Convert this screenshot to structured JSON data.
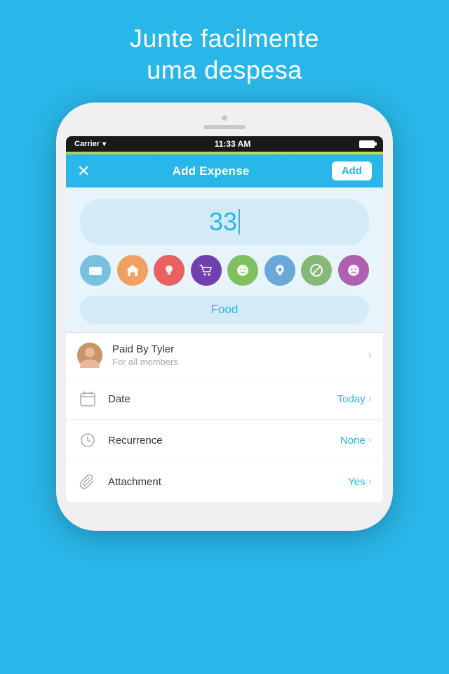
{
  "headline": {
    "line1": "Junte facilmente",
    "line2": "uma despesa"
  },
  "status_bar": {
    "carrier": "Carrier",
    "time": "11:33 AM"
  },
  "nav": {
    "title": "Add Expense",
    "add_label": "Add",
    "close_icon": "✕"
  },
  "amount": {
    "value": "33"
  },
  "categories": [
    {
      "id": "bills",
      "color": "#78c0e0",
      "icon": "💳"
    },
    {
      "id": "home",
      "color": "#f0a060",
      "icon": "🏠"
    },
    {
      "id": "food-pink",
      "color": "#f07070",
      "icon": "💡"
    },
    {
      "id": "shopping",
      "color": "#8050c0",
      "icon": "🛒"
    },
    {
      "id": "happy",
      "color": "#80c060",
      "icon": "😊"
    },
    {
      "id": "rocket",
      "color": "#70b0e0",
      "icon": "🚀"
    },
    {
      "id": "no",
      "color": "#90c080",
      "icon": "🚫"
    },
    {
      "id": "sad",
      "color": "#c070c0",
      "icon": "😢"
    }
  ],
  "category_label": "Food",
  "list_items": [
    {
      "id": "paid-by",
      "type": "avatar",
      "title": "Paid By Tyler",
      "subtitle": "For all members",
      "value": "",
      "has_chevron": true
    },
    {
      "id": "date",
      "type": "calendar",
      "icon": "📅",
      "title": "Date",
      "subtitle": "",
      "value": "Today",
      "has_chevron": true
    },
    {
      "id": "recurrence",
      "type": "clock",
      "icon": "🕐",
      "title": "Recurrence",
      "subtitle": "",
      "value": "None",
      "has_chevron": true
    },
    {
      "id": "attachment",
      "type": "paperclip",
      "icon": "📎",
      "title": "Attachment",
      "subtitle": "",
      "value": "Yes",
      "has_chevron": true
    }
  ]
}
